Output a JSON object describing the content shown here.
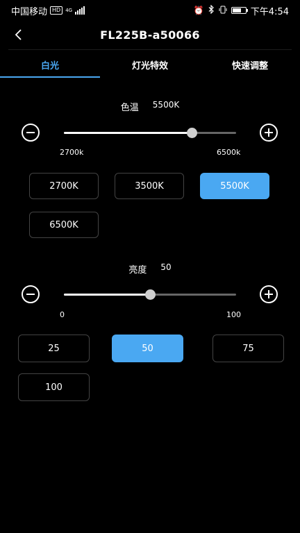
{
  "status_bar": {
    "carrier": "中国移动",
    "hd": "HD",
    "network": "4G",
    "time": "下午4:54"
  },
  "header": {
    "title": "FL225B-a50066"
  },
  "tabs": [
    {
      "label": "白光",
      "active": true
    },
    {
      "label": "灯光特效",
      "active": false
    },
    {
      "label": "快速调整",
      "active": false
    }
  ],
  "color_temp": {
    "label": "色温",
    "value_text": "5500K",
    "min_label": "2700k",
    "max_label": "6500k",
    "level": 0.74,
    "presets": [
      {
        "label": "2700K",
        "selected": false
      },
      {
        "label": "3500K",
        "selected": false
      },
      {
        "label": "5500K",
        "selected": true
      },
      {
        "label": "6500K",
        "selected": false
      }
    ]
  },
  "brightness": {
    "label": "亮度",
    "value_text": "50",
    "min_label": "0",
    "max_label": "100",
    "level": 0.5,
    "presets": [
      {
        "label": "25",
        "selected": false
      },
      {
        "label": "50",
        "selected": true
      },
      {
        "label": "75",
        "selected": false
      },
      {
        "label": "100",
        "selected": false
      }
    ]
  },
  "colors": {
    "accent": "#4aa8f2",
    "background": "#000000"
  }
}
